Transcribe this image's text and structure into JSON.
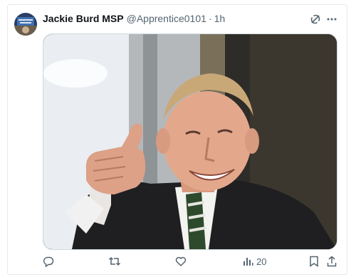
{
  "tweet": {
    "author_name": "Jackie Burd MSP",
    "handle": "@Apprentice0101",
    "separator": "·",
    "time": "1h",
    "image_description_icon": "photo-of-smiling-man-thumbs-up"
  },
  "toolbar": {
    "top_icons": [
      "grok-icon",
      "more-icon"
    ],
    "reply_icon": "reply-icon",
    "retweet_icon": "retweet-icon",
    "like_icon": "like-icon",
    "views_icon": "views-icon",
    "views_count": "20",
    "bookmark_icon": "bookmark-icon",
    "share_icon": "share-icon"
  },
  "colors": {
    "text_primary": "#0f1419",
    "text_secondary": "#536471",
    "border": "#cfd9de"
  }
}
